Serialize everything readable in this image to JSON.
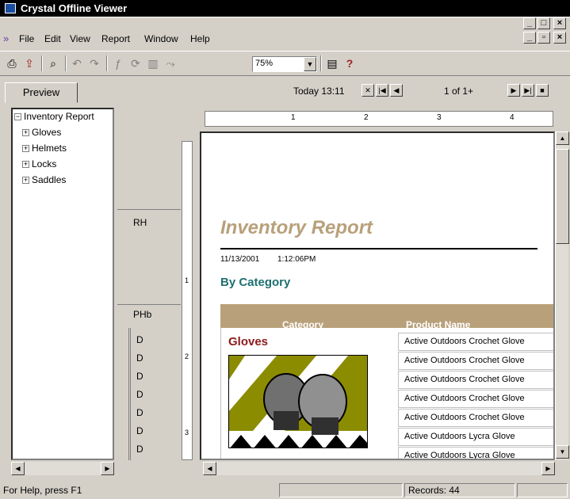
{
  "window": {
    "title": "Crystal Offline Viewer"
  },
  "menu": {
    "items": [
      "File",
      "Edit",
      "View",
      "Report",
      "Window",
      "Help"
    ]
  },
  "toolbar": {
    "zoom": "75%"
  },
  "tabs": {
    "preview": "Preview"
  },
  "nav": {
    "today": "Today 13:11",
    "page": "1 of 1+"
  },
  "tree": {
    "root": "Inventory Report",
    "items": [
      "Gloves",
      "Helmets",
      "Locks",
      "Saddles"
    ]
  },
  "sections": {
    "rh": "RH",
    "phb": "PHb",
    "detail": "D"
  },
  "ruler": {
    "marks": [
      "1",
      "2",
      "3",
      "4"
    ],
    "vmarks": [
      "1",
      "2",
      "3"
    ]
  },
  "report": {
    "title": "Inventory Report",
    "date": "11/13/2001",
    "time": "1:12:06PM",
    "subtitle": "By Category",
    "col_category": "Category",
    "col_product": "Product Name",
    "group": "Gloves",
    "products": [
      "Active Outdoors Crochet Glove",
      "Active Outdoors Crochet Glove",
      "Active Outdoors Crochet Glove",
      "Active Outdoors Crochet Glove",
      "Active Outdoors Crochet Glove",
      "Active Outdoors Lycra Glove",
      "Active Outdoors Lycra Glove"
    ]
  },
  "status": {
    "help": "For Help, press F1",
    "records": "Records: 44"
  }
}
